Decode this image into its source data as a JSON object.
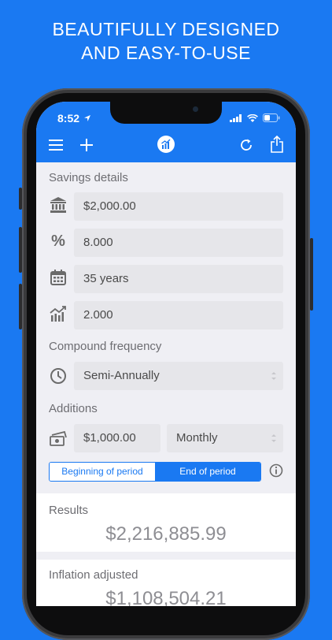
{
  "headline": {
    "line1": "BEAUTIFULLY DESIGNED",
    "line2": "AND EASY-TO-USE"
  },
  "status": {
    "time": "8:52"
  },
  "toolbar": {
    "menu_icon": "hamburger-menu-icon",
    "add_icon": "plus-icon",
    "logo_icon": "chart-logo-icon",
    "refresh_icon": "refresh-icon",
    "share_icon": "share-icon"
  },
  "savings": {
    "label": "Savings details",
    "principal": "$2,000.00",
    "rate": "8.000",
    "term": "35 years",
    "inflation": "2.000"
  },
  "compound": {
    "label": "Compound frequency",
    "value": "Semi-Annually"
  },
  "additions": {
    "label": "Additions",
    "amount": "$1,000.00",
    "frequency": "Monthly",
    "segments": [
      "Beginning of period",
      "End of period"
    ],
    "selected_segment": 1
  },
  "results": {
    "label": "Results",
    "value": "$2,216,885.99",
    "inflation_label": "Inflation adjusted",
    "inflation_value": "$1,108,504.21"
  },
  "colors": {
    "accent": "#1a79f2",
    "background": "#efeff4"
  }
}
